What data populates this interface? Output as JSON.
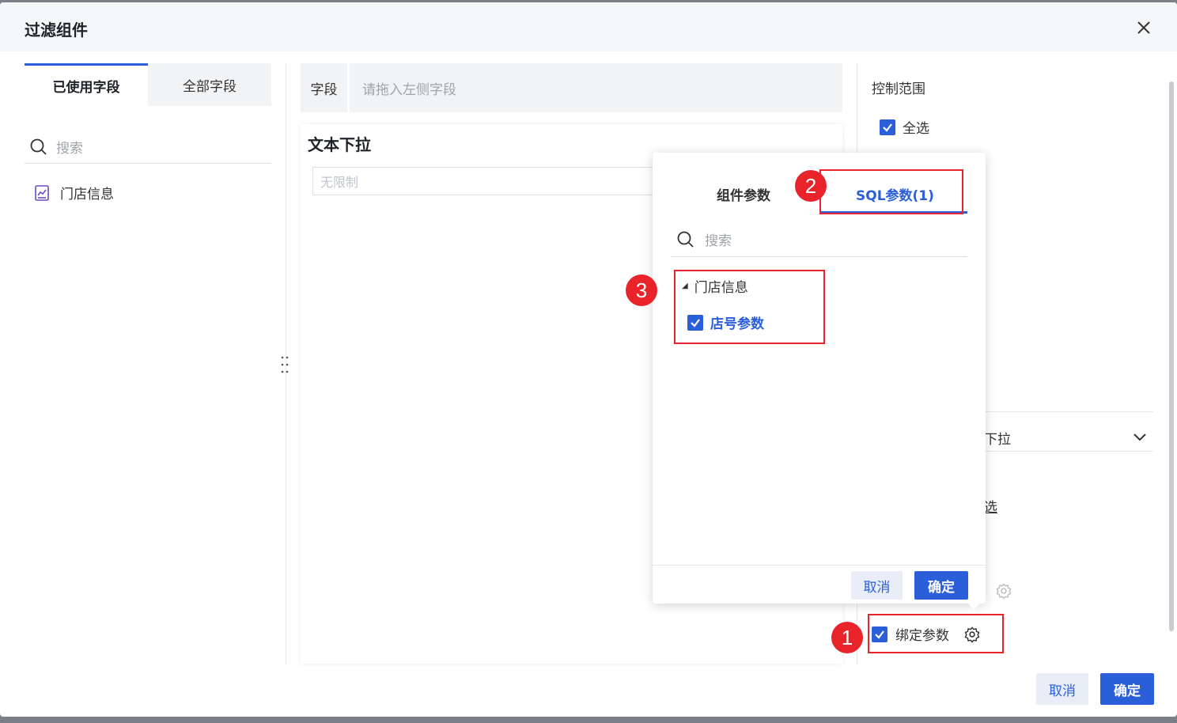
{
  "dialog": {
    "title": "过滤组件",
    "close_icon": "close-icon"
  },
  "left_panel": {
    "tabs": [
      {
        "label": "已使用字段",
        "active": true
      },
      {
        "label": "全部字段",
        "active": false
      }
    ],
    "search_placeholder": "搜索",
    "tree": [
      {
        "label": "门店信息",
        "icon": "chart-icon"
      }
    ]
  },
  "center": {
    "field_label": "字段",
    "field_placeholder": "请拖入左侧字段",
    "widget_title": "文本下拉",
    "select_placeholder": "无限制"
  },
  "right_panel": {
    "title": "控制范围",
    "select_all_label": "全选",
    "dropdown_text": "下拉",
    "partial_text": "选",
    "bind_params_label": "绑定参数",
    "bind_params_checked": true
  },
  "popup": {
    "tabs": [
      {
        "label": "组件参数",
        "active": false
      },
      {
        "label": "SQL参数(1)",
        "active": true
      }
    ],
    "search_placeholder": "搜索",
    "tree_group": "门店信息",
    "tree_child": "店号参数",
    "tree_child_checked": true,
    "cancel_label": "取消",
    "ok_label": "确定"
  },
  "footer": {
    "cancel_label": "取消",
    "ok_label": "确定"
  },
  "annotations": {
    "badges": [
      "1",
      "2",
      "3"
    ],
    "color": "#e8232a"
  },
  "colors": {
    "accent": "#2b5fd9"
  }
}
